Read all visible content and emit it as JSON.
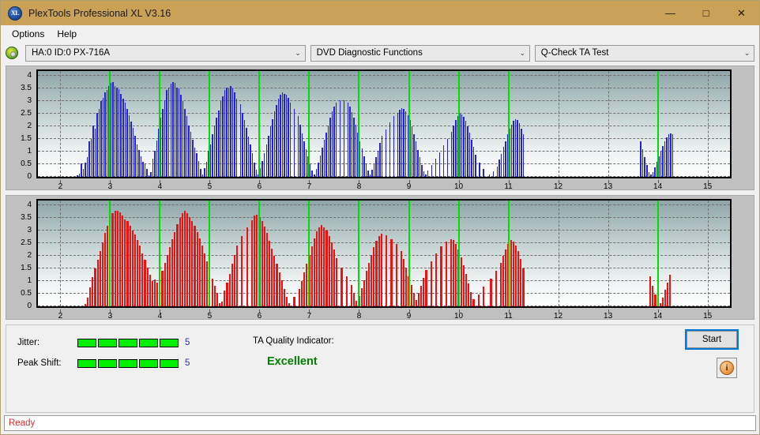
{
  "window": {
    "title": "PlexTools Professional XL V3.16",
    "icon": "xl-logo-icon",
    "minimize": "—",
    "maximize": "□",
    "close": "✕"
  },
  "menubar": {
    "items": [
      {
        "label": "Options"
      },
      {
        "label": "Help"
      }
    ]
  },
  "selectors": {
    "drive": {
      "value": "HA:0 ID:0  PX-716A",
      "arrow": "⌄",
      "icon": "disc-icon"
    },
    "function": {
      "value": "DVD Diagnostic Functions",
      "arrow": "⌄"
    },
    "test": {
      "value": "Q-Check TA Test",
      "arrow": "⌄"
    }
  },
  "chart_data": [
    {
      "type": "bar",
      "title": "",
      "series_name": "Jitter",
      "color": "#2222dd",
      "xlabel": "",
      "ylabel": "",
      "xlim": [
        1.55,
        15.45
      ],
      "ylim": [
        0,
        4.2
      ],
      "yticks": [
        0,
        0.5,
        1,
        1.5,
        2,
        2.5,
        3,
        3.5,
        4
      ],
      "ytick_labels": [
        "0",
        "0.5",
        "1",
        "1.5",
        "2",
        "2.5",
        "3",
        "3.5",
        "4"
      ],
      "xticks": [
        2,
        3,
        4,
        5,
        6,
        7,
        8,
        9,
        10,
        11,
        12,
        13,
        14,
        15
      ],
      "xtick_labels": [
        "2",
        "3",
        "4",
        "5",
        "6",
        "7",
        "8",
        "9",
        "10",
        "11",
        "12",
        "13",
        "14",
        "15"
      ],
      "grid": true,
      "markers": [
        3,
        4,
        5,
        6,
        7,
        8,
        9,
        10,
        11,
        14
      ],
      "bar_width": 0.022,
      "x": [
        2.34,
        2.38,
        2.42,
        2.46,
        2.5,
        2.54,
        2.58,
        2.62,
        2.66,
        2.7,
        2.74,
        2.78,
        2.82,
        2.86,
        2.9,
        2.94,
        2.98,
        3.02,
        3.06,
        3.1,
        3.14,
        3.18,
        3.22,
        3.26,
        3.3,
        3.34,
        3.38,
        3.42,
        3.46,
        3.5,
        3.54,
        3.58,
        3.62,
        3.66,
        3.7,
        3.74,
        3.78,
        3.82,
        3.86,
        3.9,
        3.94,
        3.98,
        4.02,
        4.06,
        4.1,
        4.14,
        4.18,
        4.22,
        4.26,
        4.3,
        4.34,
        4.38,
        4.42,
        4.46,
        4.5,
        4.54,
        4.58,
        4.62,
        4.66,
        4.7,
        4.74,
        4.78,
        4.82,
        4.86,
        4.9,
        4.94,
        4.98,
        5.02,
        5.06,
        5.1,
        5.14,
        5.18,
        5.22,
        5.26,
        5.3,
        5.34,
        5.38,
        5.42,
        5.46,
        5.5,
        5.54,
        5.62,
        5.66,
        5.7,
        5.74,
        5.78,
        5.82,
        5.86,
        5.9,
        5.94,
        5.98,
        6.02,
        6.06,
        6.1,
        6.14,
        6.18,
        6.22,
        6.26,
        6.3,
        6.34,
        6.38,
        6.42,
        6.46,
        6.5,
        6.54,
        6.58,
        6.62,
        6.7,
        6.78,
        6.82,
        6.86,
        6.9,
        6.94,
        6.98,
        7.02,
        7.06,
        7.1,
        7.14,
        7.18,
        7.22,
        7.26,
        7.3,
        7.34,
        7.38,
        7.42,
        7.46,
        7.5,
        7.54,
        7.62,
        7.7,
        7.78,
        7.82,
        7.86,
        7.9,
        7.94,
        7.98,
        8.02,
        8.06,
        8.1,
        8.14,
        8.18,
        8.22,
        8.26,
        8.3,
        8.34,
        8.38,
        8.42,
        8.46,
        8.54,
        8.62,
        8.7,
        8.78,
        8.82,
        8.86,
        8.9,
        8.94,
        8.98,
        9.02,
        9.06,
        9.1,
        9.14,
        9.18,
        9.22,
        9.26,
        9.3,
        9.34,
        9.38,
        9.46,
        9.54,
        9.62,
        9.7,
        9.78,
        9.86,
        9.9,
        9.94,
        9.98,
        10.02,
        10.06,
        10.1,
        10.14,
        10.18,
        10.22,
        10.26,
        10.3,
        10.34,
        10.42,
        10.5,
        10.62,
        10.7,
        10.78,
        10.82,
        10.86,
        10.9,
        10.94,
        10.98,
        11.02,
        11.06,
        11.1,
        11.14,
        11.18,
        11.22,
        11.26,
        11.3,
        13.66,
        13.7,
        13.74,
        13.78,
        13.82,
        13.86,
        13.9,
        13.94,
        13.98,
        14.02,
        14.06,
        14.1,
        14.14,
        14.18,
        14.22,
        14.26,
        14.3
      ],
      "values": [
        0.05,
        0.12,
        0.52,
        0.3,
        0.55,
        0.78,
        1.4,
        1.52,
        2.05,
        1.9,
        2.55,
        2.7,
        3.0,
        3.15,
        3.35,
        3.45,
        3.6,
        3.72,
        3.75,
        3.62,
        3.55,
        3.48,
        3.3,
        3.1,
        2.95,
        2.7,
        2.45,
        2.2,
        1.95,
        1.62,
        1.3,
        1.08,
        0.82,
        0.6,
        0.52,
        0.3,
        0.05,
        0.18,
        0.72,
        1.05,
        1.45,
        1.9,
        2.35,
        2.7,
        3.05,
        3.45,
        3.55,
        3.7,
        3.75,
        3.72,
        3.55,
        3.5,
        3.25,
        3.0,
        2.7,
        2.4,
        2.05,
        1.78,
        1.48,
        1.15,
        0.95,
        0.62,
        0.3,
        0.08,
        0.35,
        0.6,
        1.05,
        1.3,
        1.7,
        2.05,
        2.35,
        2.62,
        3.0,
        3.2,
        3.45,
        3.55,
        3.52,
        3.6,
        3.5,
        3.35,
        3.1,
        2.88,
        2.55,
        2.25,
        1.95,
        1.6,
        1.28,
        0.95,
        0.55,
        0.28,
        0.1,
        0.35,
        0.62,
        0.95,
        1.3,
        1.62,
        2.0,
        2.3,
        2.6,
        2.85,
        3.1,
        3.25,
        3.35,
        3.3,
        3.25,
        3.12,
        2.95,
        2.7,
        2.42,
        2.08,
        1.72,
        1.4,
        1.1,
        0.8,
        0.5,
        0.25,
        0.08,
        0.3,
        0.55,
        0.85,
        1.15,
        1.48,
        1.75,
        2.05,
        2.35,
        2.6,
        2.8,
        2.95,
        3.05,
        3.05,
        2.95,
        2.8,
        2.58,
        2.35,
        2.08,
        1.75,
        1.42,
        1.12,
        0.82,
        0.52,
        0.25,
        0.1,
        0.28,
        0.5,
        0.78,
        1.05,
        1.35,
        1.62,
        1.88,
        2.15,
        2.4,
        2.55,
        2.68,
        2.72,
        2.7,
        2.6,
        2.45,
        2.25,
        2.0,
        1.7,
        1.4,
        1.08,
        0.78,
        0.48,
        0.22,
        0.08,
        0.25,
        0.48,
        0.72,
        0.98,
        1.25,
        1.52,
        1.78,
        2.05,
        2.25,
        2.42,
        2.5,
        2.48,
        2.38,
        2.22,
        2.0,
        1.75,
        1.48,
        1.18,
        0.88,
        0.58,
        0.3,
        0.1,
        0.22,
        0.42,
        0.68,
        0.92,
        1.18,
        1.42,
        1.68,
        1.9,
        2.08,
        2.22,
        2.28,
        2.25,
        2.12,
        1.92,
        1.68,
        1.4,
        1.1,
        0.78,
        0.48,
        0.2,
        0.08,
        0.18,
        0.38,
        0.6,
        0.82,
        1.02,
        1.22,
        1.42,
        1.58,
        1.7,
        1.72,
        1.68,
        1.55,
        1.38,
        1.15,
        0.88,
        0.58,
        0.32,
        0.12,
        0.05,
        0.1,
        0.22,
        0.42,
        0.68,
        0.95,
        1.25,
        1.55,
        1.82,
        2.05,
        2.18,
        2.2,
        2.12,
        1.95,
        1.7,
        1.38,
        1.02,
        0.65,
        0.32,
        0.12,
        0.05
      ]
    },
    {
      "type": "bar",
      "title": "",
      "series_name": "Peak Shift",
      "color": "#ee1111",
      "xlabel": "",
      "ylabel": "",
      "xlim": [
        1.55,
        15.45
      ],
      "ylim": [
        0,
        4.2
      ],
      "yticks": [
        0,
        0.5,
        1,
        1.5,
        2,
        2.5,
        3,
        3.5,
        4
      ],
      "ytick_labels": [
        "0",
        "0.5",
        "1",
        "1.5",
        "2",
        "2.5",
        "3",
        "3.5",
        "4"
      ],
      "xticks": [
        2,
        3,
        4,
        5,
        6,
        7,
        8,
        9,
        10,
        11,
        12,
        13,
        14,
        15
      ],
      "xtick_labels": [
        "2",
        "3",
        "4",
        "5",
        "6",
        "7",
        "8",
        "9",
        "10",
        "11",
        "12",
        "13",
        "14",
        "15"
      ],
      "grid": true,
      "markers": [
        3,
        4,
        5,
        6,
        7,
        8,
        9,
        10,
        11,
        14
      ],
      "bar_width": 0.034,
      "x": [
        2.5,
        2.55,
        2.6,
        2.65,
        2.7,
        2.75,
        2.8,
        2.85,
        2.9,
        2.95,
        3.0,
        3.05,
        3.1,
        3.15,
        3.2,
        3.25,
        3.3,
        3.35,
        3.4,
        3.45,
        3.5,
        3.55,
        3.6,
        3.65,
        3.7,
        3.75,
        3.8,
        3.85,
        3.9,
        3.95,
        4.0,
        4.05,
        4.1,
        4.15,
        4.2,
        4.25,
        4.3,
        4.35,
        4.4,
        4.45,
        4.5,
        4.55,
        4.6,
        4.65,
        4.7,
        4.75,
        4.8,
        4.85,
        4.9,
        4.95,
        5.0,
        5.05,
        5.1,
        5.15,
        5.2,
        5.25,
        5.3,
        5.35,
        5.4,
        5.45,
        5.5,
        5.55,
        5.65,
        5.75,
        5.85,
        5.9,
        5.95,
        6.0,
        6.05,
        6.1,
        6.15,
        6.2,
        6.25,
        6.3,
        6.35,
        6.4,
        6.45,
        6.5,
        6.55,
        6.6,
        6.7,
        6.8,
        6.85,
        6.9,
        6.95,
        7.0,
        7.05,
        7.1,
        7.15,
        7.2,
        7.25,
        7.3,
        7.35,
        7.4,
        7.45,
        7.5,
        7.55,
        7.65,
        7.75,
        7.85,
        7.9,
        7.95,
        8.0,
        8.05,
        8.1,
        8.15,
        8.2,
        8.25,
        8.3,
        8.35,
        8.4,
        8.45,
        8.55,
        8.65,
        8.75,
        8.85,
        8.9,
        8.95,
        9.0,
        9.05,
        9.1,
        9.15,
        9.2,
        9.25,
        9.3,
        9.35,
        9.45,
        9.55,
        9.65,
        9.75,
        9.85,
        9.9,
        9.95,
        10.0,
        10.05,
        10.1,
        10.15,
        10.2,
        10.25,
        10.3,
        10.4,
        10.5,
        10.65,
        10.75,
        10.85,
        10.9,
        10.95,
        11.0,
        11.05,
        11.1,
        11.15,
        11.2,
        11.25,
        11.3,
        13.85,
        13.9,
        13.95,
        14.0,
        14.05,
        14.1,
        14.15,
        14.2,
        14.25
      ],
      "values": [
        0.1,
        0.35,
        0.75,
        1.15,
        1.5,
        1.85,
        2.2,
        2.55,
        2.9,
        3.2,
        3.55,
        3.7,
        3.8,
        3.78,
        3.72,
        3.6,
        3.45,
        3.4,
        3.2,
        3.0,
        2.85,
        2.62,
        2.4,
        2.1,
        1.85,
        1.55,
        1.25,
        1.0,
        1.08,
        0.95,
        1.1,
        1.42,
        1.72,
        2.05,
        2.35,
        2.65,
        2.95,
        3.25,
        3.5,
        3.7,
        3.78,
        3.7,
        3.55,
        3.4,
        3.2,
        2.95,
        2.7,
        2.42,
        2.1,
        1.8,
        1.52,
        1.1,
        0.8,
        0.52,
        0.12,
        0.18,
        0.62,
        0.95,
        1.3,
        1.7,
        2.05,
        2.42,
        2.8,
        3.15,
        3.42,
        3.6,
        3.65,
        3.55,
        3.38,
        3.18,
        2.9,
        2.6,
        2.3,
        2.0,
        1.68,
        1.35,
        1.05,
        0.7,
        0.38,
        0.12,
        0.38,
        0.68,
        1.0,
        1.35,
        1.7,
        2.05,
        2.38,
        2.7,
        2.98,
        3.15,
        3.22,
        3.15,
        3.0,
        2.8,
        2.55,
        2.25,
        1.92,
        1.55,
        1.2,
        0.85,
        0.52,
        0.22,
        0.4,
        0.72,
        1.05,
        1.4,
        1.72,
        2.05,
        2.35,
        2.6,
        2.8,
        2.88,
        2.82,
        2.68,
        2.48,
        2.2,
        1.88,
        1.55,
        1.2,
        0.85,
        0.52,
        0.25,
        0.52,
        0.82,
        1.12,
        1.45,
        1.78,
        2.1,
        2.38,
        2.58,
        2.68,
        2.62,
        2.48,
        2.25,
        1.95,
        1.62,
        1.28,
        0.92,
        0.58,
        0.28,
        0.48,
        0.78,
        1.1,
        1.42,
        1.72,
        2.0,
        2.25,
        2.48,
        2.62,
        2.58,
        2.42,
        2.18,
        1.88,
        1.52,
        1.18,
        0.82,
        0.48,
        0.2,
        0.12,
        0.35,
        0.65,
        0.95,
        1.25,
        1.55,
        1.7,
        1.62,
        1.45,
        1.2,
        0.92,
        0.62,
        0.35,
        0.15,
        0.08,
        0.22,
        0.48,
        0.78,
        1.05,
        1.22,
        1.15,
        0.95,
        0.7,
        0.48,
        0.28,
        0.15,
        0.08,
        0.05
      ]
    }
  ],
  "indicators": {
    "jitter": {
      "label": "Jitter:",
      "segments_total": 5,
      "segments_on": 5,
      "value": "5"
    },
    "peak_shift": {
      "label": "Peak Shift:",
      "segments_total": 5,
      "segments_on": 5,
      "value": "5"
    },
    "ta_quality": {
      "label": "TA Quality Indicator:",
      "value": "Excellent",
      "color": "#008000"
    }
  },
  "actions": {
    "start": {
      "label": "Start"
    },
    "info": {
      "label": "i",
      "icon": "info-icon"
    }
  },
  "statusbar": {
    "text": "Ready",
    "color": "#e03030"
  }
}
